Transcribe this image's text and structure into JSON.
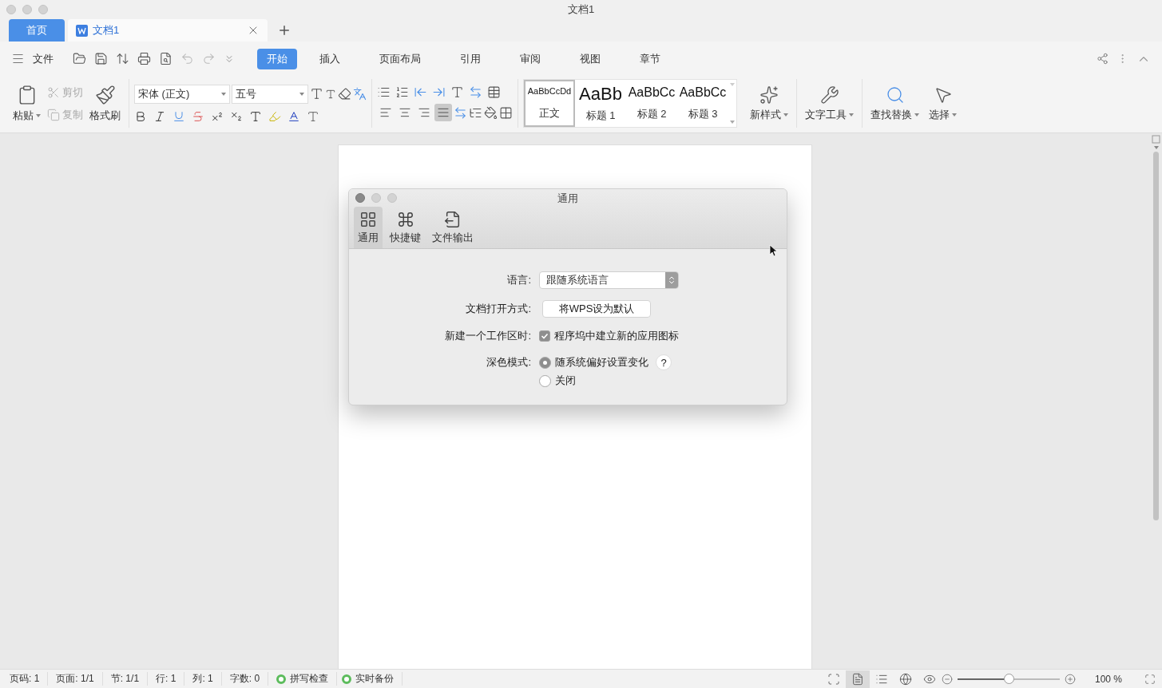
{
  "window": {
    "title": "文档1"
  },
  "tabs": [
    {
      "label": "首页",
      "kind": "home",
      "selected": false
    },
    {
      "label": "文档1",
      "kind": "doc",
      "selected": true
    }
  ],
  "menu": {
    "file": "文件",
    "tabs": [
      {
        "label": "开始",
        "selected": true
      },
      {
        "label": "插入",
        "selected": false
      },
      {
        "label": "页面布局",
        "selected": false
      },
      {
        "label": "引用",
        "selected": false
      },
      {
        "label": "审阅",
        "selected": false
      },
      {
        "label": "视图",
        "selected": false
      },
      {
        "label": "章节",
        "selected": false
      }
    ]
  },
  "clipboard": [
    {
      "label": "粘贴",
      "kind": "paste",
      "disabled": false
    },
    {
      "label": "剪切",
      "kind": "cut",
      "disabled": true
    },
    {
      "label": "复制",
      "kind": "copy",
      "disabled": true
    },
    {
      "label": "格式刷",
      "kind": "painter",
      "disabled": false
    }
  ],
  "font": {
    "family": "宋体 (正文)",
    "size": "五号"
  },
  "alignment": [
    {
      "selected": false
    },
    {
      "selected": false
    },
    {
      "selected": false
    },
    {
      "selected": true
    }
  ],
  "styles": [
    {
      "preview": "AaBbCcDd",
      "label": "正文",
      "kind": "body",
      "selected": true
    },
    {
      "preview": "AaBb",
      "label": "标题 1",
      "kind": "h1",
      "selected": false
    },
    {
      "preview": "AaBbCc",
      "label": "标题 2",
      "kind": "h2",
      "selected": false
    },
    {
      "preview": "AaBbCc",
      "label": "标题 3",
      "kind": "h3",
      "selected": false
    }
  ],
  "tools": [
    {
      "label": "新样式",
      "kind": "new-style"
    },
    {
      "label": "文字工具",
      "kind": "text-tools"
    },
    {
      "label": "查找替换",
      "kind": "find"
    },
    {
      "label": "选择",
      "kind": "select"
    }
  ],
  "dialog": {
    "title": "通用",
    "tabs": [
      {
        "label": "通用",
        "kind": "general",
        "selected": true
      },
      {
        "label": "快捷键",
        "kind": "shortcuts",
        "selected": false
      },
      {
        "label": "文件输出",
        "kind": "export",
        "selected": false
      }
    ],
    "language": {
      "label": "语言:",
      "value": "跟随系统语言"
    },
    "open_with": {
      "label": "文档打开方式:",
      "button": "将WPS设为默认"
    },
    "workspace": {
      "label": "新建一个工作区时:",
      "option": "程序坞中建立新的应用图标",
      "checked": true
    },
    "dark_mode": {
      "label": "深色模式:",
      "help": "?",
      "options": [
        {
          "label": "随系统偏好设置变化",
          "selected": true
        },
        {
          "label": "关闭",
          "selected": false
        }
      ]
    }
  },
  "status_bar": {
    "items": [
      "页码: 1",
      "页面: 1/1",
      "节: 1/1",
      "行: 1",
      "列: 1",
      "字数: 0"
    ],
    "toggles": [
      {
        "label": "拼写检查",
        "on": true
      },
      {
        "label": "实时备份",
        "on": true
      }
    ],
    "views": [
      {
        "kind": "focus",
        "selected": false
      },
      {
        "kind": "page",
        "selected": true
      },
      {
        "kind": "outline",
        "selected": false
      },
      {
        "kind": "web",
        "selected": false
      },
      {
        "kind": "read",
        "selected": false
      }
    ],
    "zoom": {
      "level": 0.5,
      "reading": "100 %"
    }
  }
}
